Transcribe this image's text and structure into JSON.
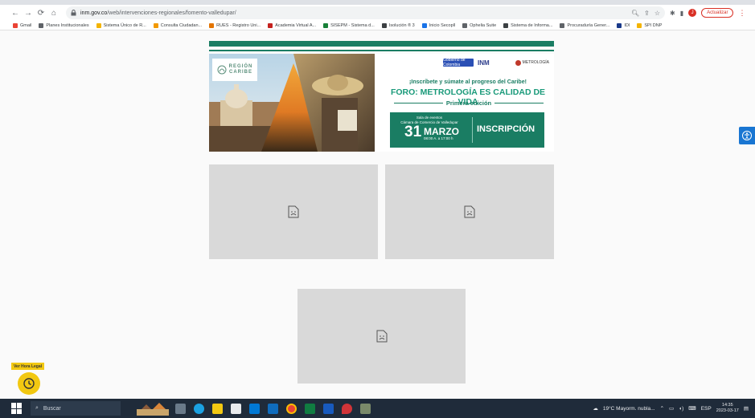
{
  "browser": {
    "url_host": "inm.gov.co",
    "url_path": "/web/intervenciones-regionales/fomento-valledupar/",
    "profile_initial": "J",
    "update_label": "Actualizar"
  },
  "bookmarks": [
    {
      "label": "Gmail",
      "color": "#ea4335"
    },
    {
      "label": "Planes Institucionales",
      "color": "#5f6368"
    },
    {
      "label": "Sistema Único de R...",
      "color": "#f4b400"
    },
    {
      "label": "Consulta Ciudadan...",
      "color": "#f29900"
    },
    {
      "label": "RUES - Registro Uni...",
      "color": "#e37400"
    },
    {
      "label": "Academia Virtual A...",
      "color": "#c5221f"
    },
    {
      "label": "SISEPM - Sistema d...",
      "color": "#188038"
    },
    {
      "label": "Isolución ® 3",
      "color": "#3c4043"
    },
    {
      "label": "Inicio Secopll",
      "color": "#1a73e8"
    },
    {
      "label": "Ophelia Suite",
      "color": "#5f6368"
    },
    {
      "label": "Sistema de Informa...",
      "color": "#3c4043"
    },
    {
      "label": "Procuraduría Gener...",
      "color": "#5f6368"
    },
    {
      "label": "IDI",
      "color": "#1a3a8a"
    },
    {
      "label": "SPI DNP",
      "color": "#f4b400"
    }
  ],
  "banner": {
    "region_line1": "REGIÓN",
    "region_line2": "CARIBE",
    "logo_gov": "Gobierno de Colombia",
    "logo_inm": "INM",
    "logo_metro": "METROLOGÍA",
    "tagline": "¡Inscríbete y súmate al progreso del Caribe!",
    "headline": "FORO: METROLOGÍA ES CALIDAD DE VIDA",
    "edition": "Primera edición",
    "venue_line1": "Sala de eventos",
    "venue_line2": "Cámara de Comercio de Valledupar",
    "day": "31",
    "month": "MARZO",
    "time": "08:00 A. a 17:00 h",
    "cta": "INSCRIPCIÓN"
  },
  "floating": {
    "hora_label": "Ver Hora Legal"
  },
  "taskbar": {
    "search_placeholder": "Buscar",
    "weather": "19°C  Mayorm. nubla...",
    "lang": "ESP",
    "time": "14:35",
    "date": "2023-03-17"
  }
}
